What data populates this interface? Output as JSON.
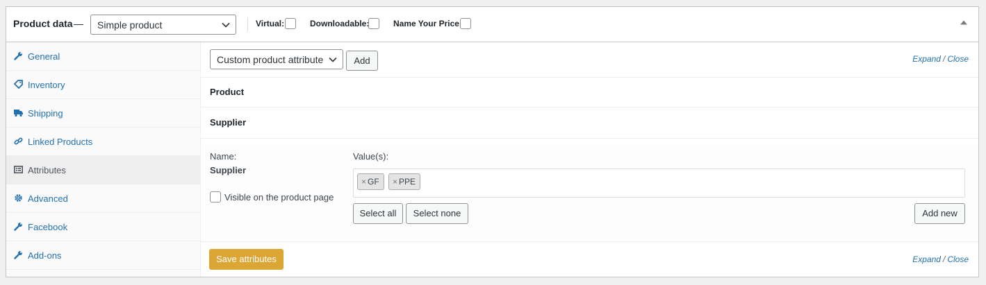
{
  "header": {
    "title": "Product data",
    "dash": "—",
    "product_type": "Simple product",
    "options": [
      {
        "label": "Virtual:"
      },
      {
        "label": "Downloadable:"
      },
      {
        "label": "Name Your Price:"
      }
    ]
  },
  "sidebar": {
    "tabs": [
      {
        "label": "General",
        "icon": "wrench-icon"
      },
      {
        "label": "Inventory",
        "icon": "tag-icon"
      },
      {
        "label": "Shipping",
        "icon": "truck-icon"
      },
      {
        "label": "Linked Products",
        "icon": "link-icon"
      },
      {
        "label": "Attributes",
        "icon": "list-icon",
        "active": true
      },
      {
        "label": "Advanced",
        "icon": "gear-icon"
      },
      {
        "label": "Facebook",
        "icon": "wrench-icon"
      },
      {
        "label": "Add-ons",
        "icon": "wrench-icon"
      }
    ]
  },
  "main": {
    "attr_type": "Custom product attribute",
    "add_label": "Add",
    "expand": "Expand",
    "slash": "/",
    "close": "Close",
    "attributes": [
      {
        "title": "Product"
      },
      {
        "title": "Supplier"
      }
    ],
    "detail": {
      "name_label": "Name:",
      "name_value": "Supplier",
      "visible_label": "Visible on the product page",
      "values_label": "Value(s):",
      "tags": [
        "GF",
        "PPE"
      ],
      "tag_remove": "×",
      "select_all": "Select all",
      "select_none": "Select none",
      "add_new": "Add new"
    },
    "save_label": "Save attributes"
  },
  "colors": {
    "link": "#2271b1",
    "save_button": "#dba633",
    "active_tab_bg": "#eeeeee"
  }
}
